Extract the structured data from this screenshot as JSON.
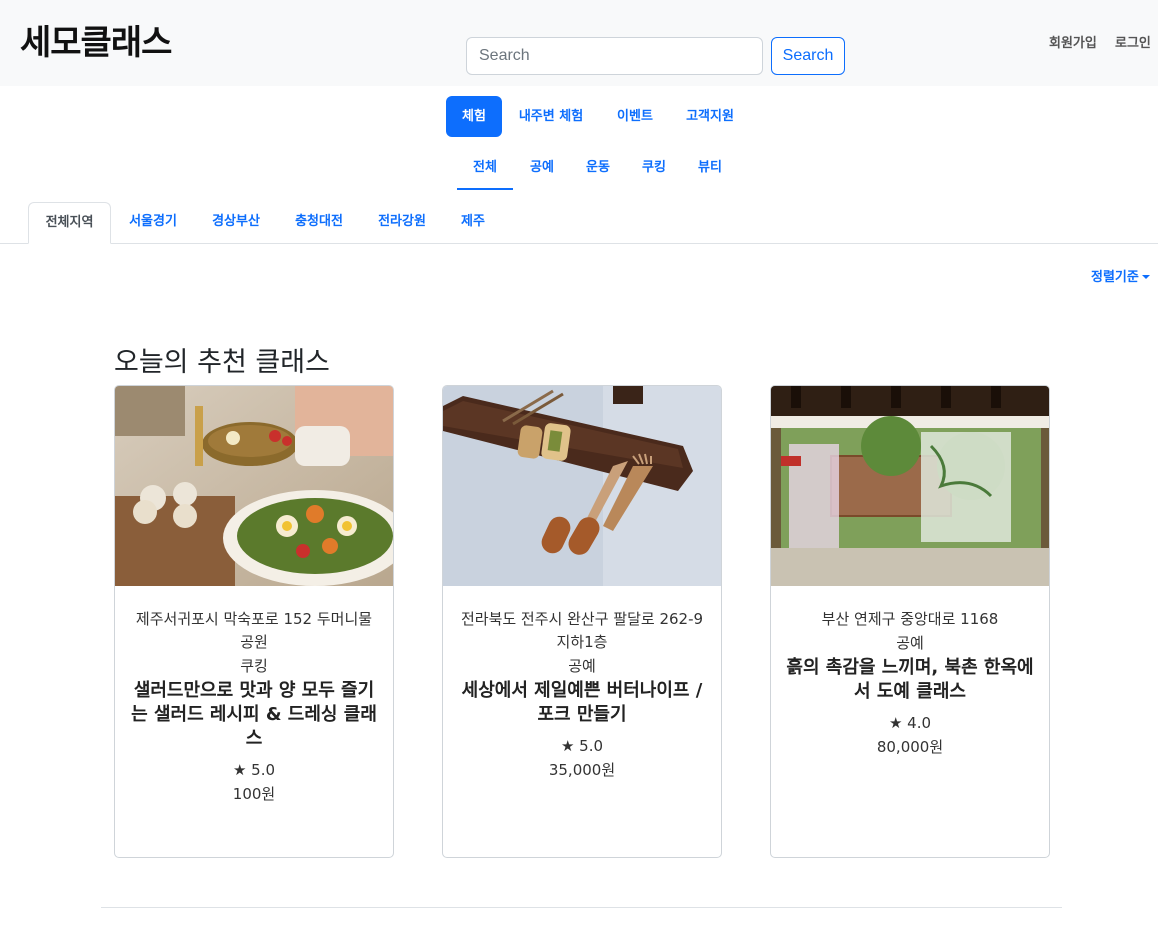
{
  "header": {
    "logo": "세모클래스",
    "search_placeholder": "Search",
    "search_button": "Search",
    "signup": "회원가입",
    "login": "로그인"
  },
  "main_tabs": [
    "체험",
    "내주변 체험",
    "이벤트",
    "고객지원"
  ],
  "sub_tabs": [
    "전체",
    "공예",
    "운동",
    "쿠킹",
    "뷰티"
  ],
  "region_tabs": [
    "전체지역",
    "서울경기",
    "경상부산",
    "충청대전",
    "전라강원",
    "제주"
  ],
  "sort_label": "정렬기준",
  "section_title": "오늘의 추천 클래스",
  "cards": [
    {
      "address": "제주서귀포시 막숙포로 152 두머니물 공원",
      "category": "쿠킹",
      "title": "샐러드만으로 맛과 양 모두 즐기는 샐러드 레시피 & 드레싱 클래스",
      "rating": "★ 5.0",
      "price": "100원"
    },
    {
      "address": "전라북도 전주시 완산구 팔달로 262-9 지하1층",
      "category": "공예",
      "title": "세상에서 제일예쁜 버터나이프 / 포크 만들기",
      "rating": "★ 5.0",
      "price": "35,000원"
    },
    {
      "address": "부산 연제구 중앙대로 1168",
      "category": "공예",
      "title": "흙의 촉감을 느끼며, 북촌 한옥에서 도예 클래스",
      "rating": "★ 4.0",
      "price": "80,000원"
    }
  ]
}
